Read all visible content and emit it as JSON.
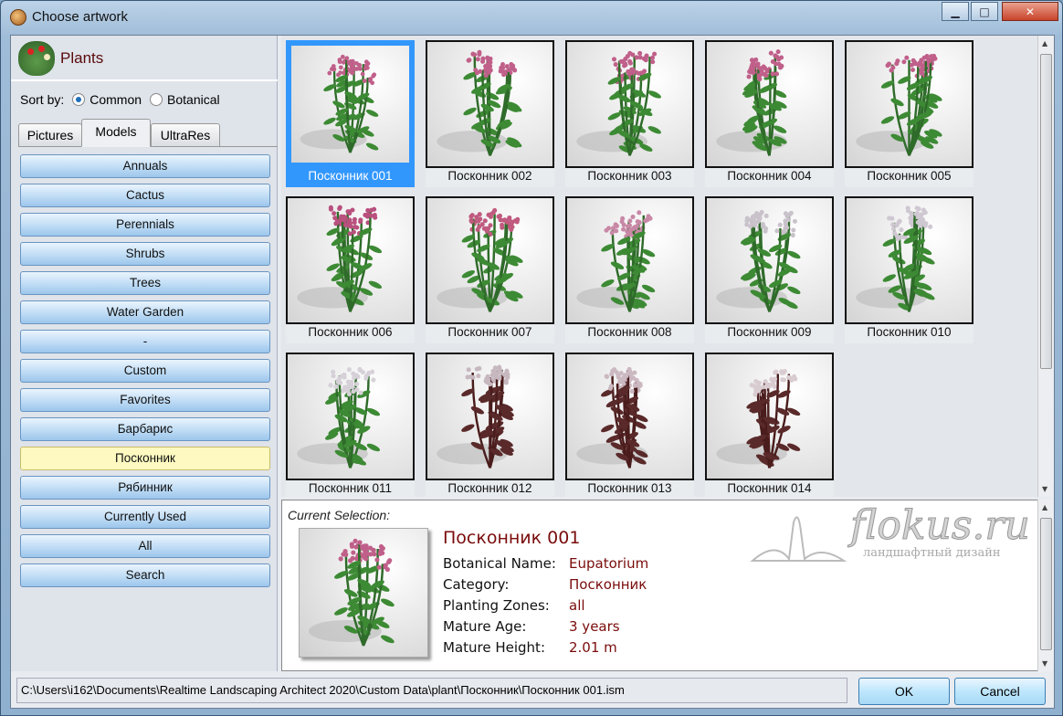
{
  "window": {
    "title": "Choose artwork",
    "minimize": "▁",
    "maximize": "□",
    "close": "✕"
  },
  "library": {
    "title": "Plants",
    "sort_label": "Sort by:",
    "sort_options": [
      {
        "label": "Common",
        "selected": true
      },
      {
        "label": "Botanical",
        "selected": false
      }
    ]
  },
  "tabs": [
    {
      "label": "Pictures"
    },
    {
      "label": "Models",
      "active": true
    },
    {
      "label": "UltraRes"
    }
  ],
  "categories": [
    "Annuals",
    "Cactus",
    "Perennials",
    "Shrubs",
    "Trees",
    "Water Garden",
    "-",
    "Custom",
    "Favorites",
    "Барбарис",
    "Посконник",
    "Рябинник",
    "Currently Used",
    "All",
    "Search"
  ],
  "selected_category": "Посконник",
  "items": [
    {
      "label": "Посконник 001",
      "flower": "#c0608a",
      "selected": true
    },
    {
      "label": "Посконник 002",
      "flower": "#c0608a"
    },
    {
      "label": "Посконник 003",
      "flower": "#c0608a"
    },
    {
      "label": "Посконник 004",
      "flower": "#c0608a"
    },
    {
      "label": "Посконник 005",
      "flower": "#c0608a"
    },
    {
      "label": "Посконник 006",
      "flower": "#b9507e"
    },
    {
      "label": "Посконник 007",
      "flower": "#c05a7e"
    },
    {
      "label": "Посконник 008",
      "flower": "#c888a6"
    },
    {
      "label": "Посконник 009",
      "flower": "#c9c2ca"
    },
    {
      "label": "Посконник 010",
      "flower": "#cfc8d2"
    },
    {
      "label": "Посконник 011",
      "flower": "#d6d0d8"
    },
    {
      "label": "Посконник 012",
      "flower": "#c7b8c0",
      "stem": "#4a1c1c"
    },
    {
      "label": "Посконник 013",
      "flower": "#cbb8c0",
      "stem": "#4a1c1c"
    },
    {
      "label": "Посконник 014",
      "flower": "#d9ccd0",
      "stem": "#4a1c1c"
    }
  ],
  "details": {
    "heading": "Current Selection:",
    "name": "Посконник 001",
    "fields": [
      {
        "key": "Botanical Name:",
        "value": "Eupatorium"
      },
      {
        "key": "Category:",
        "value": "Посконник"
      },
      {
        "key": "Planting Zones:",
        "value": "all"
      },
      {
        "key": "Mature Age:",
        "value": "3 years"
      },
      {
        "key": "Mature Height:",
        "value": "2.01 m"
      }
    ],
    "watermark": {
      "text": "flokus.ru",
      "subtitle": "ландшафтный дизайн"
    }
  },
  "path": "C:\\Users\\i162\\Documents\\Realtime Landscaping Architect 2020\\Custom Data\\plant\\Посконник\\Посконник 001.ism",
  "buttons": {
    "ok": "OK",
    "cancel": "Cancel"
  }
}
